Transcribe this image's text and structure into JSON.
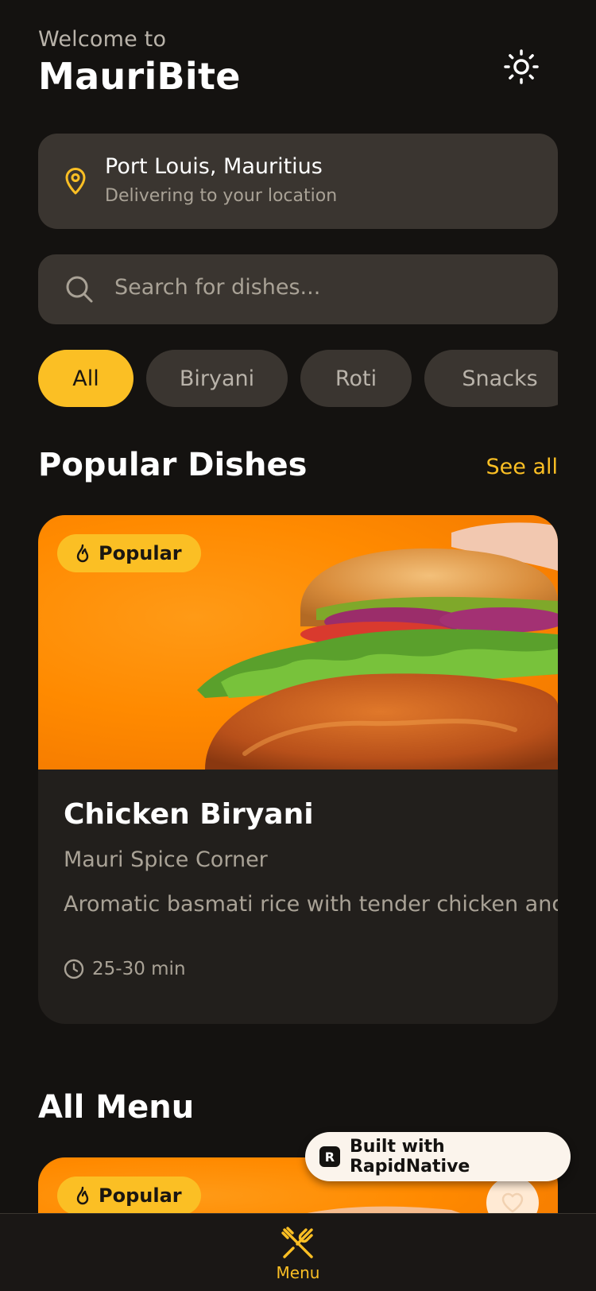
{
  "header": {
    "welcome": "Welcome to",
    "brand": "MauriBite"
  },
  "location": {
    "title": "Port Louis, Mauritius",
    "subtitle": "Delivering to your location"
  },
  "search": {
    "placeholder": "Search for dishes..."
  },
  "categories": [
    {
      "label": "All",
      "active": true
    },
    {
      "label": "Biryani",
      "active": false
    },
    {
      "label": "Roti",
      "active": false
    },
    {
      "label": "Snacks",
      "active": false
    }
  ],
  "popular": {
    "title": "Popular Dishes",
    "see_all": "See all",
    "card": {
      "badge": "Popular",
      "name": "Chicken Biryani",
      "restaurant": "Mauri Spice Corner",
      "description": "Aromatic basmati rice with tender chicken and a",
      "time": "25-30 min"
    }
  },
  "all_menu": {
    "title": "All Menu",
    "card": {
      "badge": "Popular"
    }
  },
  "rapid_badge": {
    "label": "Built with RapidNative"
  },
  "bottom_nav": {
    "items": [
      {
        "label": "Menu",
        "icon": "fork-knife-icon",
        "active": true
      }
    ]
  },
  "colors": {
    "background": "#141210",
    "accent": "#fbbf24",
    "surface": "#3a3530",
    "card": "#221f1c"
  }
}
